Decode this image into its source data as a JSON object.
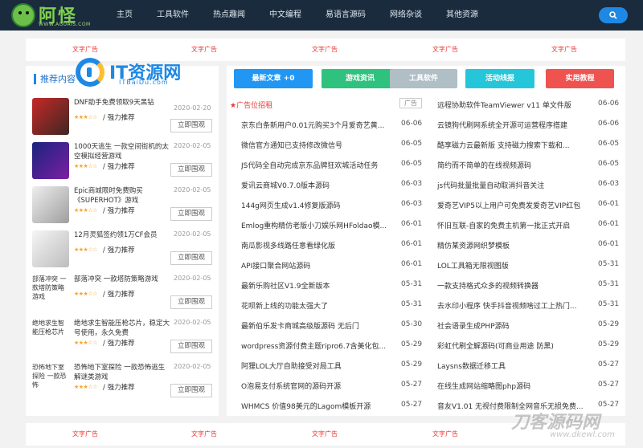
{
  "header": {
    "logo_text": "阿怪",
    "logo_sub": "WWW.AGUAIS.COM",
    "nav": [
      "主页",
      "工具软件",
      "热点趣闻",
      "中文编程",
      "易语言源码",
      "网络杂谈",
      "其他资源"
    ],
    "search_icon": "search-icon"
  },
  "ads": {
    "label": "文字广告"
  },
  "left": {
    "title": "推荐内容",
    "overlay_logo": "IT资源网",
    "overlay_sub": "ITBaiDu.com",
    "items": [
      {
        "title": "DNF助手免费领取9天黑钻",
        "date": "2020-02-20",
        "stars": "★★★☆☆",
        "tag": "/ 强力推荐",
        "button": "立即围观",
        "thumb_alt": ""
      },
      {
        "title": "1000天逃生 一款空间街机的太空模拟经营游戏",
        "date": "2020-02-05",
        "stars": "★★★☆☆",
        "tag": "/ 强力推荐",
        "button": "立即围观",
        "thumb_alt": ""
      },
      {
        "title": "Epic商城限时免费购买《SUPERHOT》游戏",
        "date": "2020-02-05",
        "stars": "★★★☆☆",
        "tag": "/ 强力推荐",
        "button": "立即围观",
        "thumb_alt": ""
      },
      {
        "title": "12月灵狐签约领1万CF会员",
        "date": "2020-02-05",
        "stars": "★★★☆☆",
        "tag": "/ 强力推荐",
        "button": "立即围观",
        "thumb_alt": ""
      },
      {
        "title": "部落冲突 一款塔防策略游戏",
        "date": "2020-02-05",
        "stars": "★★★☆☆",
        "tag": "/ 强力推荐",
        "button": "立即围观",
        "thumb_alt": "部落冲突 一款塔防策略游戏"
      },
      {
        "title": "绝地求生智能压枪芯片，稳定大号使用，永久免费",
        "date": "2020-02-05",
        "stars": "★★★☆☆",
        "tag": "/ 强力推荐",
        "button": "立即围观",
        "thumb_alt": "绝地求生智能压枪芯片"
      },
      {
        "title": "恐怖地下室探险 一款恐怖逃生解谜类游戏",
        "date": "2020-02-05",
        "stars": "★★★☆☆",
        "tag": "/ 强力推荐",
        "button": "立即围观",
        "thumb_alt": "恐怖地下室探险 一款恐怖"
      }
    ]
  },
  "right": {
    "tabs": [
      {
        "label": "最新文章 +0",
        "color": "#2196f3"
      },
      {
        "label": "游戏资讯",
        "color": "#2ec27e"
      },
      {
        "label": "工具软件",
        "color": "#b0bec5"
      },
      {
        "label": "活动线报",
        "color": "#26c6da"
      },
      {
        "label": "实用教程",
        "color": "#ef5350"
      }
    ],
    "left_list": [
      {
        "text": "广告位招租",
        "date": "广告",
        "is_ad": true
      },
      {
        "text": "京东白条新用户0.01元购买3个月爱奇艺黄...",
        "date": "06-06"
      },
      {
        "text": "微信官方通知已支持修改微信号",
        "date": "06-05"
      },
      {
        "text": "JS代码全自动完成京东品牌狂欢城活动任务",
        "date": "06-05"
      },
      {
        "text": "爱讯云商城V0.7.0版本源码",
        "date": "06-03"
      },
      {
        "text": "144g网页生成v1.4修复版源码",
        "date": "06-03"
      },
      {
        "text": "Emlog重构精仿老版小刀娱乐网HFoldao模...",
        "date": "06-01"
      },
      {
        "text": "南瓜影视多线路任意看绿化版",
        "date": "06-01"
      },
      {
        "text": "API接口聚合网站源码",
        "date": "06-01"
      },
      {
        "text": "最新乐购社区V1.9全新版本",
        "date": "05-31"
      },
      {
        "text": "花呗新上线的功能太强大了",
        "date": "05-31"
      },
      {
        "text": "最新伯乐发卡商城高级版源码 无后门",
        "date": "05-30"
      },
      {
        "text": "wordpress资源付费主题ripro6.7含美化包...",
        "date": "05-29"
      },
      {
        "text": "阿狸LOL大厅自助接受对局工具",
        "date": "05-29"
      },
      {
        "text": "O泡易支付系统官网的源码开源",
        "date": "05-27"
      },
      {
        "text": "WHMCS 价值98美元的Lagom模板开源",
        "date": "05-27"
      }
    ],
    "right_list": [
      {
        "text": "远程协助软件TeamViewer v11 单文件版",
        "date": "06-06"
      },
      {
        "text": "云镜狗代刷网系统全开源可运营程序搭建",
        "date": "06-06"
      },
      {
        "text": "酷享磁力云最新版 支持磁力搜索下载和...",
        "date": "06-05"
      },
      {
        "text": "简约而不简单的在线视频源码",
        "date": "06-05"
      },
      {
        "text": "js代码批量批量自动取消抖音关注",
        "date": "06-03"
      },
      {
        "text": "爱奇艺VIP5以上用户可免费发爱奇艺VIP红包",
        "date": "06-01"
      },
      {
        "text": "怀旧互联-自家的免费主机第一批正式开启",
        "date": "06-01"
      },
      {
        "text": "精仿某资源网织梦模板",
        "date": "06-01"
      },
      {
        "text": "LOL工具箱无限视图版",
        "date": "05-31"
      },
      {
        "text": "一款支持格式众多的视频转换器",
        "date": "05-31"
      },
      {
        "text": "去水印小程序 快手抖音视频啥过工上热门...",
        "date": "05-31"
      },
      {
        "text": "社会语录生成PHP源码",
        "date": "05-29"
      },
      {
        "text": "彩虹代刷全解源码(可商业用途 防黑)",
        "date": "05-29"
      },
      {
        "text": "Laysns数据迁移工具",
        "date": "05-27"
      },
      {
        "text": "在线生成网站缩略图php源码",
        "date": "05-27"
      },
      {
        "text": "音友V1.01 无视付费限制全网音乐无损免费...",
        "date": "05-27"
      }
    ]
  },
  "watermark": {
    "text": "刀客源码网",
    "sub": "www.dkewl.com"
  }
}
